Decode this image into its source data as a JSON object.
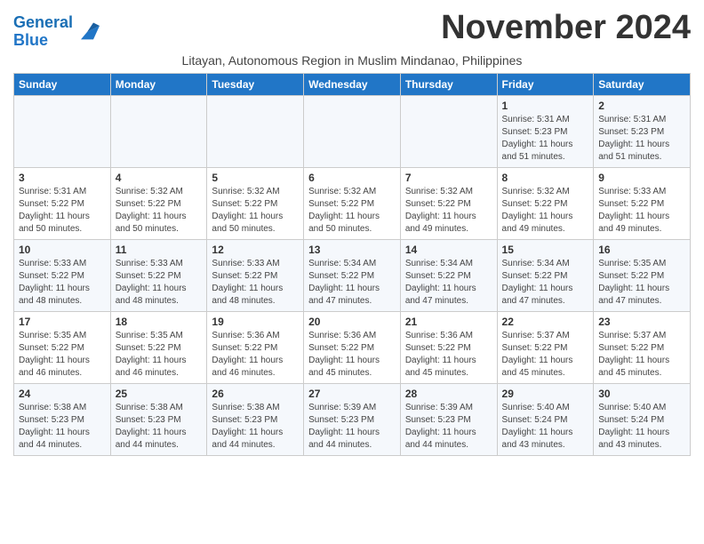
{
  "header": {
    "logo_line1": "General",
    "logo_line2": "Blue",
    "month_title": "November 2024",
    "subtitle": "Litayan, Autonomous Region in Muslim Mindanao, Philippines"
  },
  "weekdays": [
    "Sunday",
    "Monday",
    "Tuesday",
    "Wednesday",
    "Thursday",
    "Friday",
    "Saturday"
  ],
  "weeks": [
    [
      {
        "day": "",
        "info": ""
      },
      {
        "day": "",
        "info": ""
      },
      {
        "day": "",
        "info": ""
      },
      {
        "day": "",
        "info": ""
      },
      {
        "day": "",
        "info": ""
      },
      {
        "day": "1",
        "info": "Sunrise: 5:31 AM\nSunset: 5:23 PM\nDaylight: 11 hours and 51 minutes."
      },
      {
        "day": "2",
        "info": "Sunrise: 5:31 AM\nSunset: 5:23 PM\nDaylight: 11 hours and 51 minutes."
      }
    ],
    [
      {
        "day": "3",
        "info": "Sunrise: 5:31 AM\nSunset: 5:22 PM\nDaylight: 11 hours and 50 minutes."
      },
      {
        "day": "4",
        "info": "Sunrise: 5:32 AM\nSunset: 5:22 PM\nDaylight: 11 hours and 50 minutes."
      },
      {
        "day": "5",
        "info": "Sunrise: 5:32 AM\nSunset: 5:22 PM\nDaylight: 11 hours and 50 minutes."
      },
      {
        "day": "6",
        "info": "Sunrise: 5:32 AM\nSunset: 5:22 PM\nDaylight: 11 hours and 50 minutes."
      },
      {
        "day": "7",
        "info": "Sunrise: 5:32 AM\nSunset: 5:22 PM\nDaylight: 11 hours and 49 minutes."
      },
      {
        "day": "8",
        "info": "Sunrise: 5:32 AM\nSunset: 5:22 PM\nDaylight: 11 hours and 49 minutes."
      },
      {
        "day": "9",
        "info": "Sunrise: 5:33 AM\nSunset: 5:22 PM\nDaylight: 11 hours and 49 minutes."
      }
    ],
    [
      {
        "day": "10",
        "info": "Sunrise: 5:33 AM\nSunset: 5:22 PM\nDaylight: 11 hours and 48 minutes."
      },
      {
        "day": "11",
        "info": "Sunrise: 5:33 AM\nSunset: 5:22 PM\nDaylight: 11 hours and 48 minutes."
      },
      {
        "day": "12",
        "info": "Sunrise: 5:33 AM\nSunset: 5:22 PM\nDaylight: 11 hours and 48 minutes."
      },
      {
        "day": "13",
        "info": "Sunrise: 5:34 AM\nSunset: 5:22 PM\nDaylight: 11 hours and 47 minutes."
      },
      {
        "day": "14",
        "info": "Sunrise: 5:34 AM\nSunset: 5:22 PM\nDaylight: 11 hours and 47 minutes."
      },
      {
        "day": "15",
        "info": "Sunrise: 5:34 AM\nSunset: 5:22 PM\nDaylight: 11 hours and 47 minutes."
      },
      {
        "day": "16",
        "info": "Sunrise: 5:35 AM\nSunset: 5:22 PM\nDaylight: 11 hours and 47 minutes."
      }
    ],
    [
      {
        "day": "17",
        "info": "Sunrise: 5:35 AM\nSunset: 5:22 PM\nDaylight: 11 hours and 46 minutes."
      },
      {
        "day": "18",
        "info": "Sunrise: 5:35 AM\nSunset: 5:22 PM\nDaylight: 11 hours and 46 minutes."
      },
      {
        "day": "19",
        "info": "Sunrise: 5:36 AM\nSunset: 5:22 PM\nDaylight: 11 hours and 46 minutes."
      },
      {
        "day": "20",
        "info": "Sunrise: 5:36 AM\nSunset: 5:22 PM\nDaylight: 11 hours and 45 minutes."
      },
      {
        "day": "21",
        "info": "Sunrise: 5:36 AM\nSunset: 5:22 PM\nDaylight: 11 hours and 45 minutes."
      },
      {
        "day": "22",
        "info": "Sunrise: 5:37 AM\nSunset: 5:22 PM\nDaylight: 11 hours and 45 minutes."
      },
      {
        "day": "23",
        "info": "Sunrise: 5:37 AM\nSunset: 5:22 PM\nDaylight: 11 hours and 45 minutes."
      }
    ],
    [
      {
        "day": "24",
        "info": "Sunrise: 5:38 AM\nSunset: 5:23 PM\nDaylight: 11 hours and 44 minutes."
      },
      {
        "day": "25",
        "info": "Sunrise: 5:38 AM\nSunset: 5:23 PM\nDaylight: 11 hours and 44 minutes."
      },
      {
        "day": "26",
        "info": "Sunrise: 5:38 AM\nSunset: 5:23 PM\nDaylight: 11 hours and 44 minutes."
      },
      {
        "day": "27",
        "info": "Sunrise: 5:39 AM\nSunset: 5:23 PM\nDaylight: 11 hours and 44 minutes."
      },
      {
        "day": "28",
        "info": "Sunrise: 5:39 AM\nSunset: 5:23 PM\nDaylight: 11 hours and 44 minutes."
      },
      {
        "day": "29",
        "info": "Sunrise: 5:40 AM\nSunset: 5:24 PM\nDaylight: 11 hours and 43 minutes."
      },
      {
        "day": "30",
        "info": "Sunrise: 5:40 AM\nSunset: 5:24 PM\nDaylight: 11 hours and 43 minutes."
      }
    ]
  ]
}
